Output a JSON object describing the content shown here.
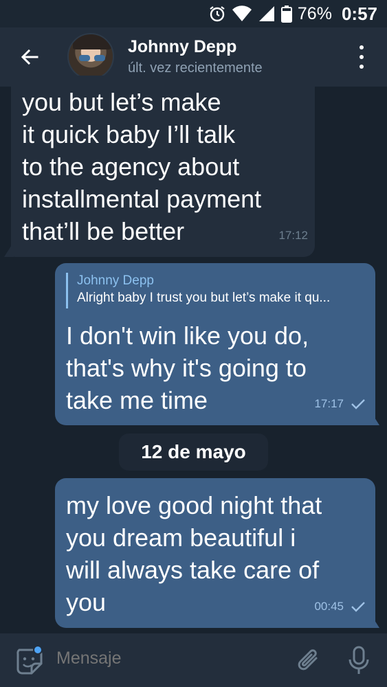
{
  "status_bar": {
    "battery": "76%",
    "time": "0:57",
    "icons": [
      "alarm-icon",
      "wifi-icon",
      "signal-icon",
      "battery-icon"
    ]
  },
  "header": {
    "contact_name": "Johnny Depp",
    "contact_status": "últ. vez recientemente",
    "icons": [
      "back-arrow-icon",
      "avatar",
      "more-vert-icon"
    ]
  },
  "messages": [
    {
      "direction": "incoming",
      "lines": [
        "you but let’s make",
        "it quick baby I’ll talk",
        "to the agency about",
        "installmental payment",
        "that’ll be better"
      ],
      "time": "17:12"
    },
    {
      "direction": "outgoing",
      "reply": {
        "name": "Johnny Depp",
        "text": "Alright baby I trust you but let’s make it qu..."
      },
      "lines": [
        "I don't win like you do,",
        "that's why it's going to",
        "take me time"
      ],
      "time": "17:17",
      "read_icon": "check-icon"
    },
    {
      "direction": "outgoing",
      "lines": [
        "my love good night that",
        "you dream beautiful i",
        "will always take care of",
        "you"
      ],
      "time": "00:45",
      "read_icon": "check-icon"
    }
  ],
  "date_separator": "12 de mayo",
  "input_bar": {
    "placeholder": "Mensaje",
    "icons": [
      "sticker-icon",
      "attach-icon",
      "mic-icon"
    ]
  },
  "colors": {
    "background": "#18222d",
    "header": "#232e3c",
    "incoming_bubble": "#232e3c",
    "outgoing_bubble": "#3d5f86",
    "accent": "#8cc1ef"
  }
}
